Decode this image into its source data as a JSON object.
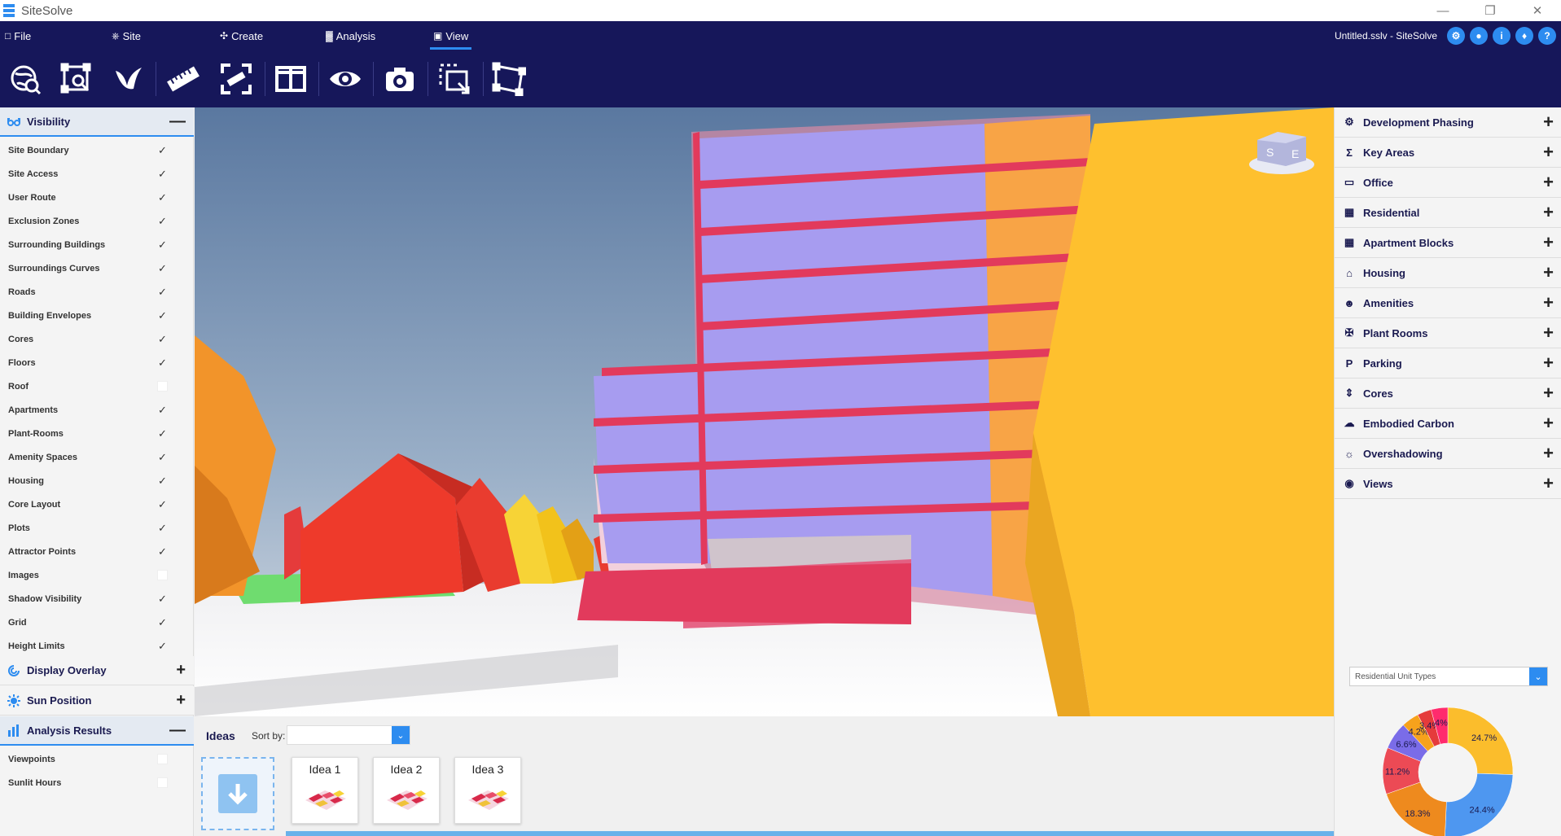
{
  "window": {
    "title": "SiteSolve",
    "filename": "Untitled.sslv - SiteSolve"
  },
  "menu": [
    {
      "label": "File",
      "icon": "file-icon"
    },
    {
      "label": "Site",
      "icon": "site-icon"
    },
    {
      "label": "Create",
      "icon": "create-icon"
    },
    {
      "label": "Analysis",
      "icon": "analysis-icon"
    },
    {
      "label": "View",
      "icon": "camera-icon",
      "active": true
    }
  ],
  "header_buttons": [
    "settings-icon",
    "user-icon",
    "info-icon",
    "bell-icon",
    "help-icon"
  ],
  "toolbar": [
    "globe-view-icon",
    "zoom-extents-icon",
    "bird-view-icon",
    "measure-icon",
    "fullscreen-icon",
    "split-view-icon",
    "eye-icon",
    "camera-icon",
    "crop-icon",
    "perspective-icon"
  ],
  "visibility": {
    "title": "Visibility",
    "items": [
      {
        "label": "Site Boundary",
        "checked": true
      },
      {
        "label": "Site Access",
        "checked": true
      },
      {
        "label": "User Route",
        "checked": true
      },
      {
        "label": "Exclusion Zones",
        "checked": true
      },
      {
        "label": "Surrounding Buildings",
        "checked": true
      },
      {
        "label": "Surroundings Curves",
        "checked": true
      },
      {
        "label": "Roads",
        "checked": true
      },
      {
        "label": "Building Envelopes",
        "checked": true
      },
      {
        "label": "Cores",
        "checked": true
      },
      {
        "label": "Floors",
        "checked": true
      },
      {
        "label": "Roof",
        "checked": false
      },
      {
        "label": "Apartments",
        "checked": true
      },
      {
        "label": "Plant-Rooms",
        "checked": true
      },
      {
        "label": "Amenity Spaces",
        "checked": true
      },
      {
        "label": "Housing",
        "checked": true
      },
      {
        "label": "Core Layout",
        "checked": true
      },
      {
        "label": "Plots",
        "checked": true
      },
      {
        "label": "Attractor Points",
        "checked": true
      },
      {
        "label": "Images",
        "checked": false
      },
      {
        "label": "Shadow Visibility",
        "checked": true
      },
      {
        "label": "Grid",
        "checked": true
      },
      {
        "label": "Height Limits",
        "checked": true
      }
    ]
  },
  "display_overlay": {
    "title": "Display Overlay"
  },
  "sun_position": {
    "title": "Sun Position"
  },
  "analysis_results": {
    "title": "Analysis Results",
    "items": [
      {
        "label": "Viewpoints",
        "checked": false
      },
      {
        "label": "Sunlit Hours",
        "checked": false
      }
    ]
  },
  "compass": {
    "s": "S",
    "e": "E"
  },
  "right_panel": [
    {
      "label": "Development Phasing",
      "icon": "phasing-icon"
    },
    {
      "label": "Key Areas",
      "icon": "sigma-icon"
    },
    {
      "label": "Office",
      "icon": "monitor-icon"
    },
    {
      "label": "Residential",
      "icon": "building-icon"
    },
    {
      "label": "Apartment Blocks",
      "icon": "building-icon"
    },
    {
      "label": "Housing",
      "icon": "house-icon"
    },
    {
      "label": "Amenities",
      "icon": "people-icon"
    },
    {
      "label": "Plant Rooms",
      "icon": "fan-icon"
    },
    {
      "label": "Parking",
      "icon": "parking-icon"
    },
    {
      "label": "Cores",
      "icon": "elevator-icon"
    },
    {
      "label": "Embodied Carbon",
      "icon": "cloud-icon"
    },
    {
      "label": "Overshadowing",
      "icon": "sun-icon"
    },
    {
      "label": "Views",
      "icon": "eye-icon"
    }
  ],
  "chart_selector": {
    "value": "Residential Unit Types"
  },
  "chart_data": {
    "type": "pie",
    "donut": true,
    "slices": [
      {
        "label": "24.7%",
        "value": 24.7,
        "color": "#fbbd2c"
      },
      {
        "label": "24.4%",
        "value": 24.4,
        "color": "#4e97f0"
      },
      {
        "label": "18.3%",
        "value": 18.3,
        "color": "#ee8a1e"
      },
      {
        "label": "11.2%",
        "value": 11.2,
        "color": "#ec4a55"
      },
      {
        "label": "6.6%",
        "value": 6.6,
        "color": "#7a6ce8"
      },
      {
        "label": "4.2%",
        "value": 4.2,
        "color": "#f7a21c"
      },
      {
        "label": "3.4%",
        "value": 3.4,
        "color": "#e53b3b"
      },
      {
        "label": "4%",
        "value": 4.0,
        "color": "#ff2b6d"
      }
    ]
  },
  "ideas": {
    "title": "Ideas",
    "sort_label": "Sort by:",
    "sort_value": "",
    "cards": [
      "Idea 1",
      "Idea 2",
      "Idea 3"
    ]
  },
  "colors": {
    "accent": "#2d8cf0",
    "header": "#16175a"
  }
}
